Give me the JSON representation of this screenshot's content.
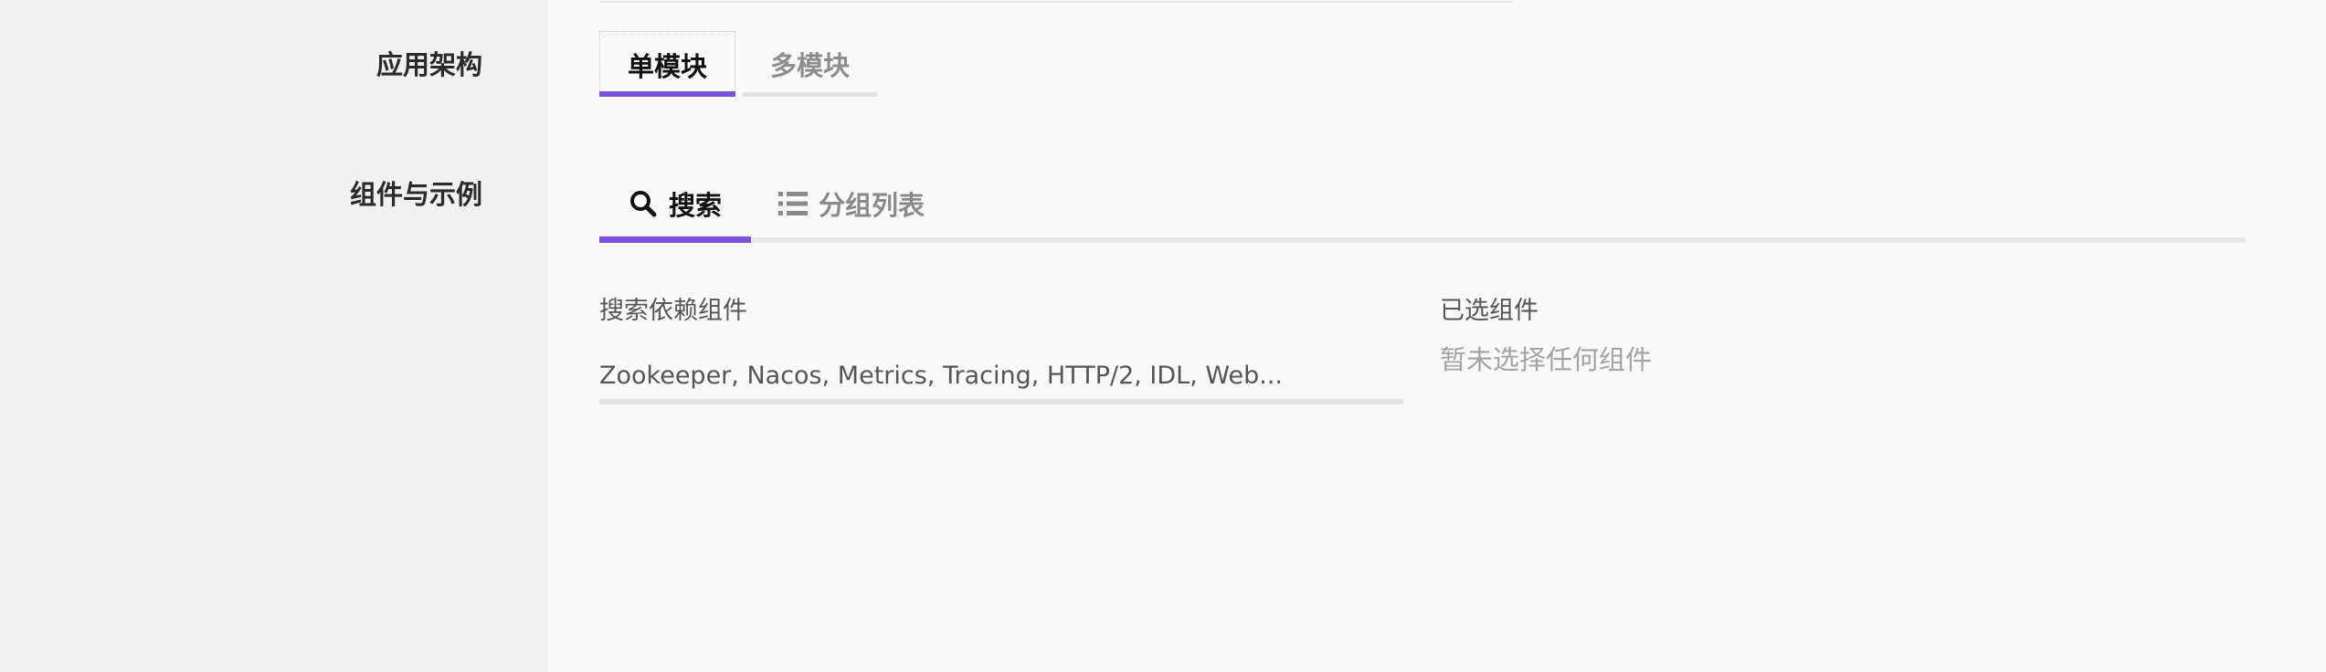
{
  "form": {
    "architecture_label": "应用架构",
    "architecture_options": [
      {
        "label": "单模块",
        "selected": true
      },
      {
        "label": "多模块",
        "selected": false
      }
    ],
    "components_label": "组件与示例"
  },
  "tabs": [
    {
      "label": "搜索",
      "icon": "search-icon",
      "active": true
    },
    {
      "label": "分组列表",
      "icon": "list-icon",
      "active": false
    }
  ],
  "search": {
    "label": "搜索依赖组件",
    "placeholder": "Zookeeper, Nacos, Metrics, Tracing, HTTP/2, IDL, Web..."
  },
  "selected": {
    "label": "已选组件",
    "empty_text": "暂未选择任何组件"
  },
  "colors": {
    "accent": "#7b52e0",
    "sidebar_bg": "#f1f1f1",
    "content_bg": "#f9f9f9"
  }
}
